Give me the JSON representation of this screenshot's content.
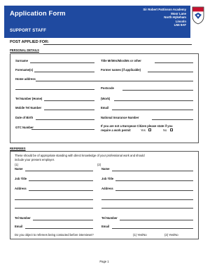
{
  "header": {
    "title": "Application Form",
    "subtitle": "SUPPORT STAFF",
    "address": [
      "Sir Robert Pattinson Academy",
      "Moor Lane",
      "North Hykeham",
      "Lincoln",
      "LN6 9AF"
    ]
  },
  "post_label": "POST APPLIED FOR:",
  "personal": {
    "heading": "PERSONAL DETAILS",
    "surname": "Surname",
    "title": "Title Mr/Mrs/Miss/Ms or other",
    "forenames": "Forename(s)",
    "former_names": "Former names (if applicable)",
    "home_address": "Home address",
    "postcode": "Postcode",
    "tel_home": "Tel Number (Home)",
    "work": "(Work)",
    "mobile": "Mobile Tel Number",
    "email": "Email",
    "dob": "Date of Birth",
    "ni": "National Insurance Number",
    "gtc": "GTC Number",
    "eu_line1": "If you are not a European Citizen please state if you",
    "eu_line2": "require a work permit",
    "yes": "Yes",
    "no": "No"
  },
  "referees": {
    "heading": "REFEREES",
    "intro_line1": "These should be of appropriate standing with direct knowledge of your professional work and should",
    "intro_line2": "include your present employer.",
    "num1": "(1)",
    "num2": "(2)",
    "name": "Name",
    "job_title": "Job Title",
    "address": "Address",
    "tel_number": "Tel Number",
    "email": "Email",
    "contact_question": "Do you object to referees being contacted before interviews?",
    "opt1": "(1)  Yes/No",
    "opt2": "(2)  Yes/No"
  },
  "footer": {
    "page": "Page 1"
  },
  "colors": {
    "banner": "#1f4aa0",
    "crest_red": "#c8102e"
  }
}
